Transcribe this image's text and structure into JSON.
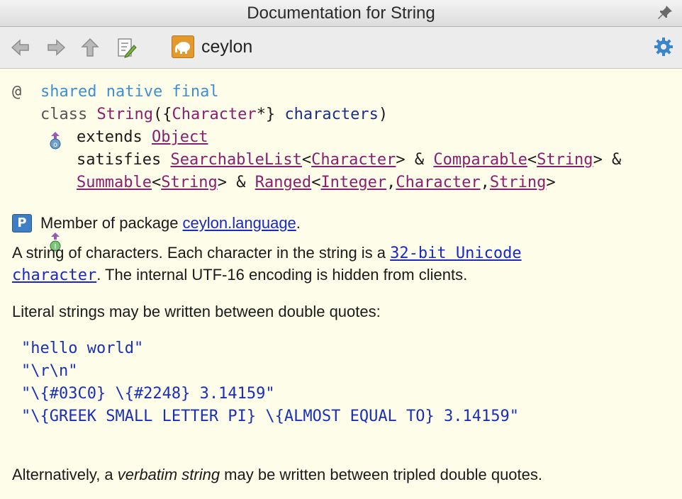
{
  "window": {
    "title": "Documentation for String",
    "pin_icon": "pin-icon"
  },
  "toolbar": {
    "back_icon": "arrow-left-icon",
    "forward_icon": "arrow-right-icon",
    "up_icon": "arrow-up-icon",
    "edit_source_icon": "edit-source-icon",
    "module_icon": "elephant-module-icon",
    "module_label": "ceylon",
    "settings_icon": "gear-icon"
  },
  "declaration": {
    "annotation_marker": "@",
    "modifiers": "shared native final",
    "class_kw": "class",
    "class_name": "String",
    "param_open": "({",
    "param_type": "Character",
    "param_star": "*}",
    "param_name": "characters",
    "param_close": ")",
    "extends_kw": "extends",
    "extends_type": "Object",
    "satisfies_kw": "satisfies",
    "sat1": "SearchableList",
    "sat1_arg": "Character",
    "sat2": "Comparable",
    "sat2_arg": "String",
    "sat3": "Summable",
    "sat3_arg": "String",
    "sat4": "Ranged",
    "sat4_arg1": "Integer",
    "sat4_arg2": "Character",
    "sat4_arg3": "String",
    "lt": "<",
    "gt": ">",
    "amp": " & ",
    "comma": ","
  },
  "package": {
    "icon_letter": "P",
    "prefix": "Member of package ",
    "link": "ceylon.language",
    "suffix": "."
  },
  "description": {
    "p1_a": "A string of characters. Each character in the string is a ",
    "p1_link1": "32-bit Unicode",
    "p1_link2": "character",
    "p1_b": ". The internal UTF-16 encoding is hidden from clients.",
    "p2": "Literal strings may be written between double quotes:",
    "code": [
      "\"hello world\"",
      "\"\\r\\n\"",
      "\"\\{#03C0} \\{#2248} 3.14159\"",
      "\"\\{GREEK SMALL LETTER PI} \\{ALMOST EQUAL TO} 3.14159\""
    ],
    "p3_a": "Alternatively, a ",
    "p3_em": "verbatim string",
    "p3_b": " may be written between tripled double quotes."
  }
}
